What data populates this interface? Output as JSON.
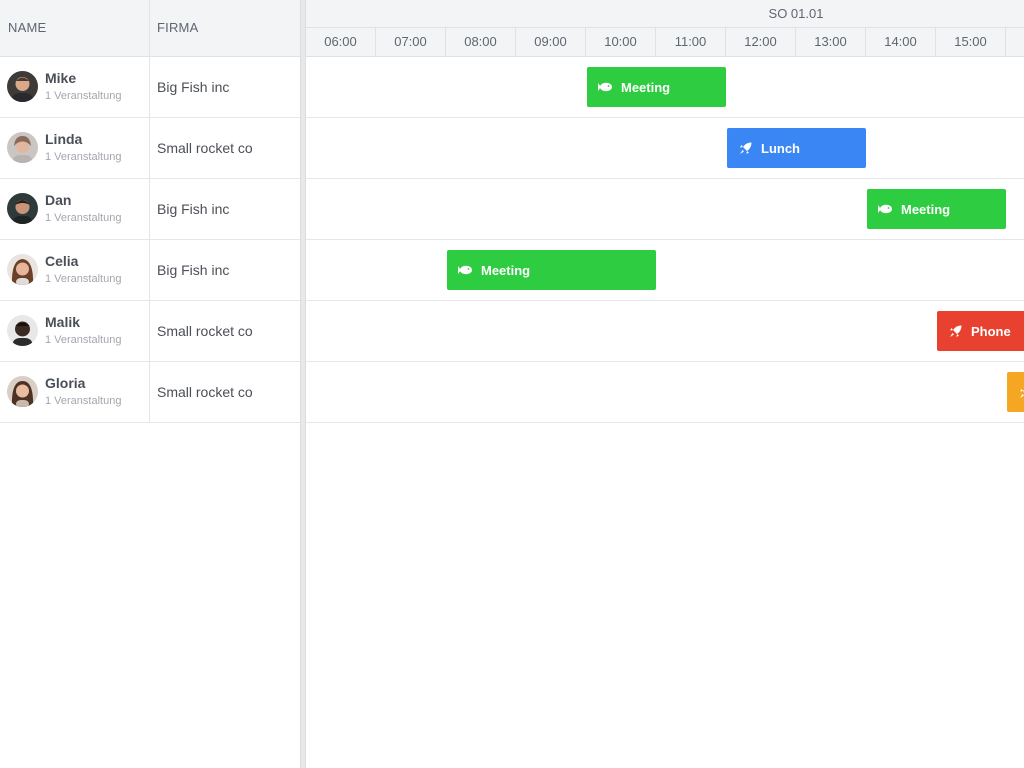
{
  "columns": {
    "name": "NAME",
    "firma": "FIRMA"
  },
  "timeline": {
    "day": "SO 01.01",
    "hours": [
      "06:00",
      "07:00",
      "08:00",
      "09:00",
      "10:00",
      "11:00",
      "12:00",
      "13:00",
      "14:00",
      "15:00"
    ]
  },
  "rows": [
    {
      "name": "Mike",
      "sub": "1 Veranstaltung",
      "firma": "Big Fish inc",
      "event": {
        "label": "Meeting",
        "icon": "fish-icon",
        "color": "#2ecc40",
        "start": "10:00",
        "end": "12:00"
      }
    },
    {
      "name": "Linda",
      "sub": "1 Veranstaltung",
      "firma": "Small rocket co",
      "event": {
        "label": "Lunch",
        "icon": "rocket-icon",
        "color": "#3a86f5",
        "start": "12:00",
        "end": "14:00"
      }
    },
    {
      "name": "Dan",
      "sub": "1 Veranstaltung",
      "firma": "Big Fish inc",
      "event": {
        "label": "Meeting",
        "icon": "fish-icon",
        "color": "#2ecc40",
        "start": "14:00",
        "end": "16:00"
      }
    },
    {
      "name": "Celia",
      "sub": "1 Veranstaltung",
      "firma": "Big Fish inc",
      "event": {
        "label": "Meeting",
        "icon": "fish-icon",
        "color": "#2ecc40",
        "start": "08:00",
        "end": "11:00"
      }
    },
    {
      "name": "Malik",
      "sub": "1 Veranstaltung",
      "firma": "Small rocket co",
      "event": {
        "label": "Phone",
        "icon": "rocket-icon",
        "color": "#e8412f",
        "start": "15:00",
        "end": "17:00"
      }
    },
    {
      "name": "Gloria",
      "sub": "1 Veranstaltung",
      "firma": "Small rocket co",
      "event": {
        "label": "",
        "icon": "rocket-icon",
        "color": "#f5a623",
        "start": "16:00",
        "end": "18:00"
      }
    }
  ]
}
